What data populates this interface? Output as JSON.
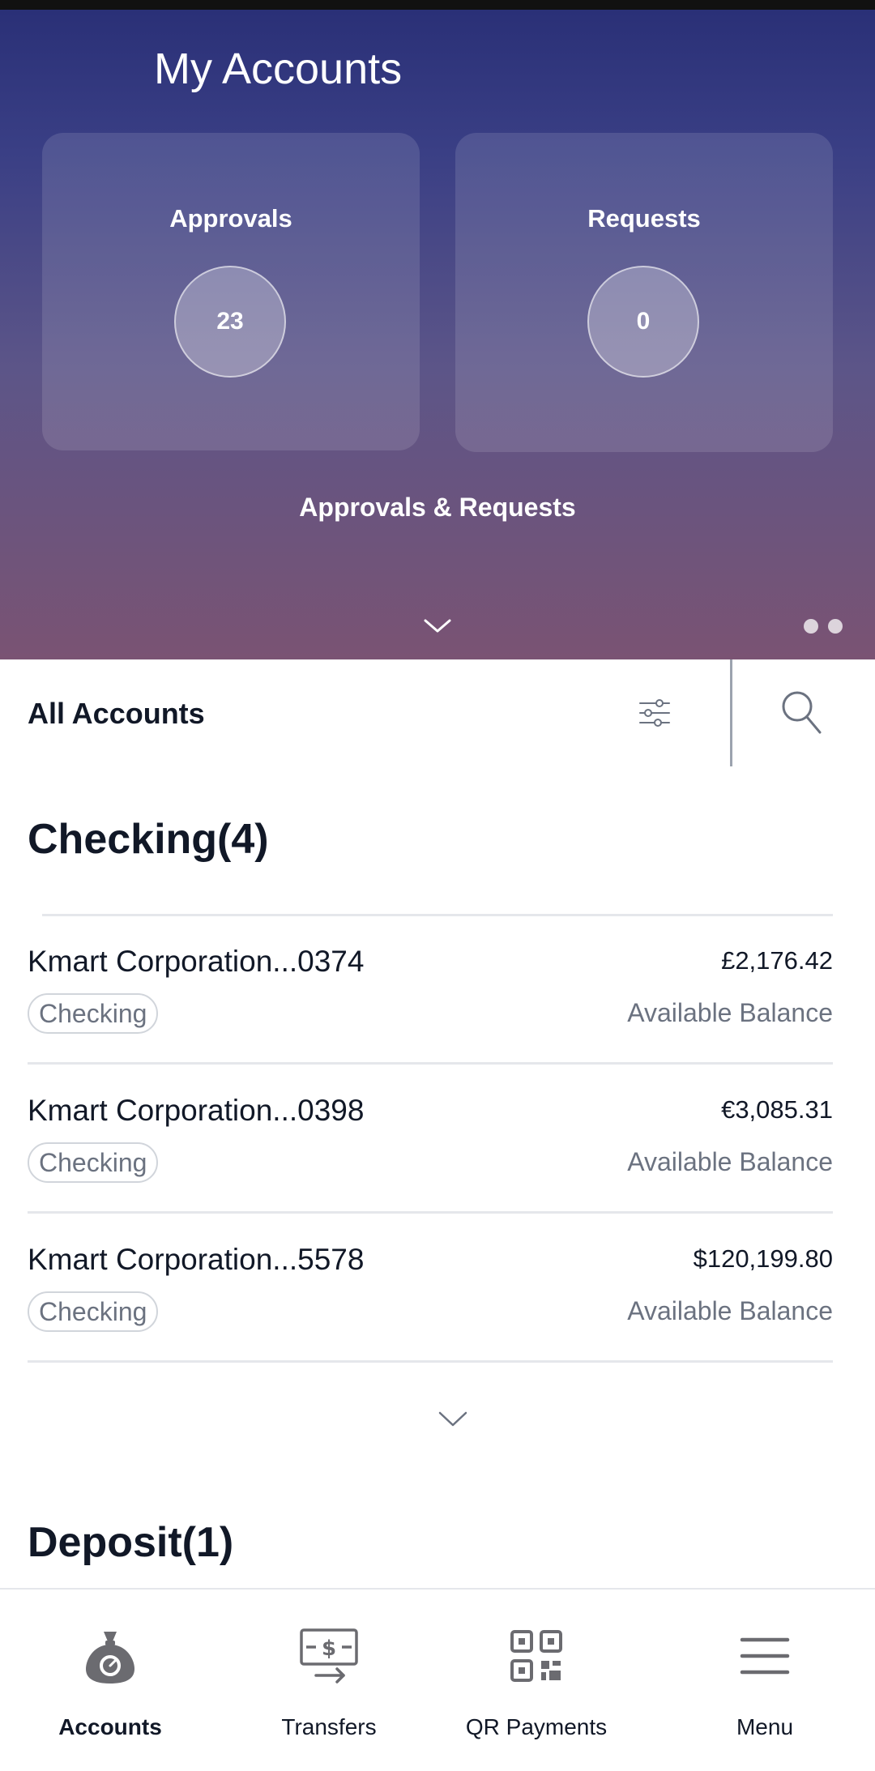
{
  "header": {
    "title": "My Accounts"
  },
  "cards": [
    {
      "label": "Approvals",
      "count": "23"
    },
    {
      "label": "Requests",
      "count": "0"
    }
  ],
  "hero_link": "Approvals & Requests",
  "carousel": {
    "pages": 2
  },
  "filter": {
    "label": "All Accounts",
    "filter_icon": "sliders-icon",
    "search_icon": "search-icon"
  },
  "sections": [
    {
      "title": "Checking(4)",
      "accounts": [
        {
          "name": "Kmart Corporation...0374",
          "amount": "£2,176.42",
          "type": "Checking",
          "balance_label": "Available Balance"
        },
        {
          "name": "Kmart Corporation...0398",
          "amount": "€3,085.31",
          "type": "Checking",
          "balance_label": "Available Balance"
        },
        {
          "name": "Kmart Corporation...5578",
          "amount": "$120,199.80",
          "type": "Checking",
          "balance_label": "Available Balance"
        }
      ]
    },
    {
      "title": "Deposit(1)"
    }
  ],
  "bottom_nav": [
    {
      "label": "Accounts",
      "icon": "money-bag-icon",
      "active": true
    },
    {
      "label": "Transfers",
      "icon": "transfer-icon",
      "active": false
    },
    {
      "label": "QR Payments",
      "icon": "qr-code-icon",
      "active": false
    },
    {
      "label": "Menu",
      "icon": "hamburger-menu-icon",
      "active": false
    }
  ],
  "colors": {
    "hero_top": "#2a3077",
    "hero_bottom": "#7a5373",
    "text_primary": "#111827",
    "text_muted": "#6b7280",
    "divider": "#e5e7eb"
  }
}
